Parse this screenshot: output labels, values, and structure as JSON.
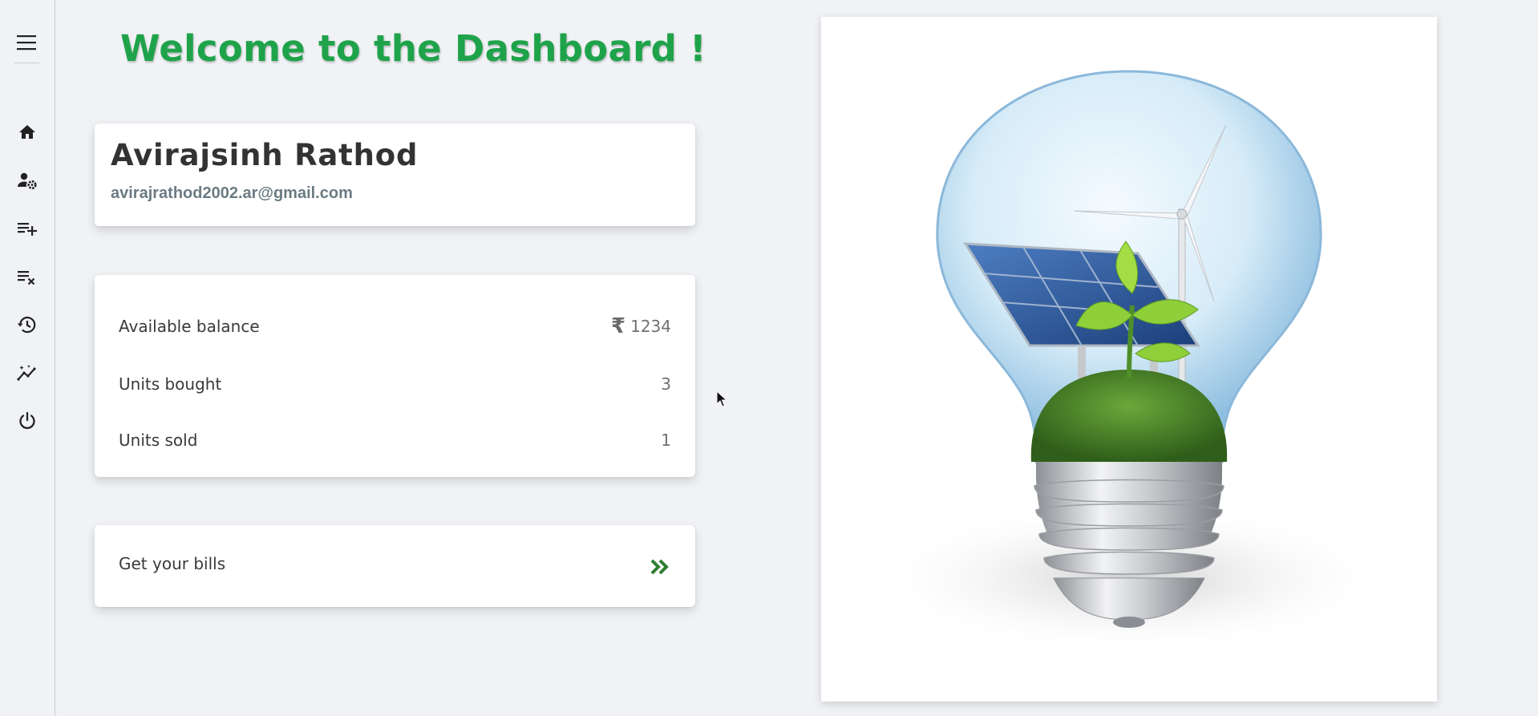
{
  "sidebar": {
    "menu_icon": "hamburger-menu-icon",
    "items": [
      {
        "icon": "home-icon"
      },
      {
        "icon": "user-settings-icon"
      },
      {
        "icon": "playlist-add-icon"
      },
      {
        "icon": "playlist-remove-icon"
      },
      {
        "icon": "history-icon"
      },
      {
        "icon": "insights-icon"
      },
      {
        "icon": "power-icon"
      }
    ]
  },
  "header": {
    "title": "Welcome to the Dashboard !"
  },
  "profile": {
    "name": "Avirajsinh Rathod",
    "email": "avirajrathod2002.ar@gmail.com"
  },
  "stats": {
    "balance_label": "Available balance",
    "balance_currency": "₹",
    "balance_value": "1234",
    "bought_label": "Units bought",
    "bought_value": "3",
    "sold_label": "Units sold",
    "sold_value": "1"
  },
  "bills": {
    "label": "Get your bills",
    "icon": "double-chevron-right-icon"
  },
  "hero_image": {
    "subject": "light bulb containing solar panel, wind turbine and plant"
  },
  "colors": {
    "accent_green": "#1fa34a",
    "arrow_green": "#2e7d32",
    "background": "#f0f2f5"
  }
}
